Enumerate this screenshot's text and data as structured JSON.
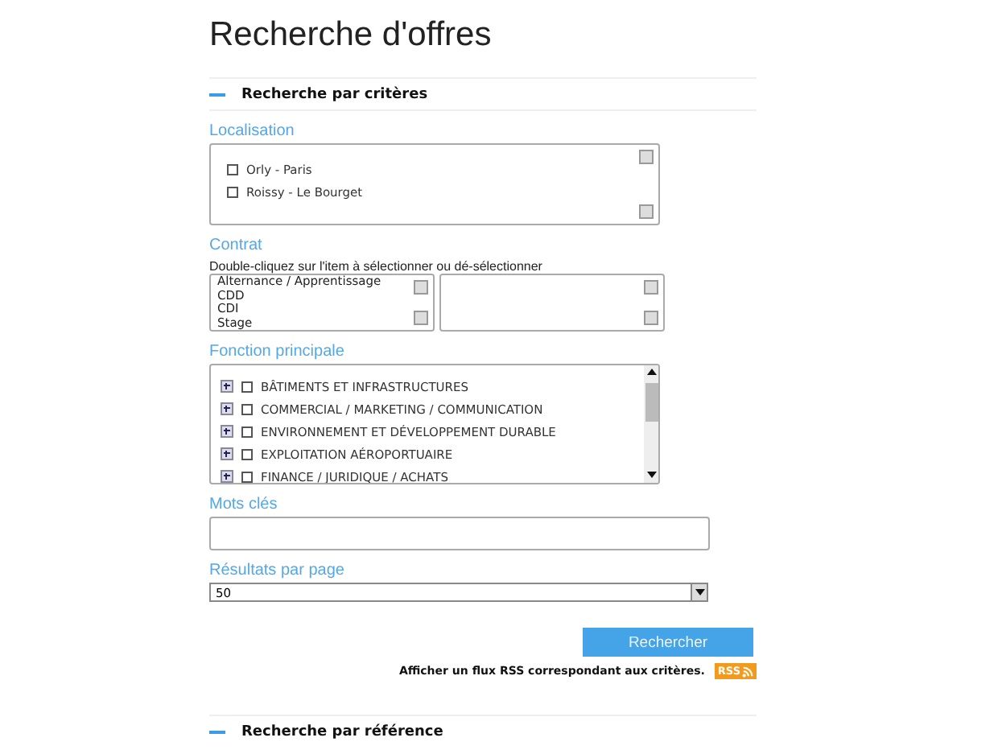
{
  "title": "Recherche d'offres",
  "section": {
    "label": "Recherche par critères",
    "expanded": true
  },
  "localisation": {
    "label": "Localisation",
    "items": [
      {
        "label": "Orly - Paris",
        "checked": false
      },
      {
        "label": "Roissy - Le Bourget",
        "checked": false
      }
    ]
  },
  "contrat": {
    "label": "Contrat",
    "hint": "Double-cliquez sur l'item à sélectionner ou dé-sélectionner",
    "available": [
      "Alternance / Apprentissage",
      "CDD",
      "CDI",
      "Stage"
    ]
  },
  "fonction": {
    "label": "Fonction principale",
    "items": [
      {
        "label": "BÂTIMENTS ET INFRASTRUCTURES",
        "checked": false
      },
      {
        "label": "COMMERCIAL / MARKETING / COMMUNICATION",
        "checked": false
      },
      {
        "label": "ENVIRONNEMENT ET DÉVELOPPEMENT DURABLE",
        "checked": false
      },
      {
        "label": "EXPLOITATION AÉROPORTUAIRE",
        "checked": false
      },
      {
        "label": "FINANCE / JURIDIQUE / ACHATS",
        "checked": false
      }
    ]
  },
  "keywords": {
    "label": "Mots clés"
  },
  "results": {
    "label": "Résultats par page",
    "value": "50"
  },
  "search_button": "Rechercher",
  "rss": {
    "text": "Afficher un flux RSS correspondant aux critères.",
    "badge": "RSS"
  },
  "section2": {
    "label": "Recherche par référence"
  }
}
